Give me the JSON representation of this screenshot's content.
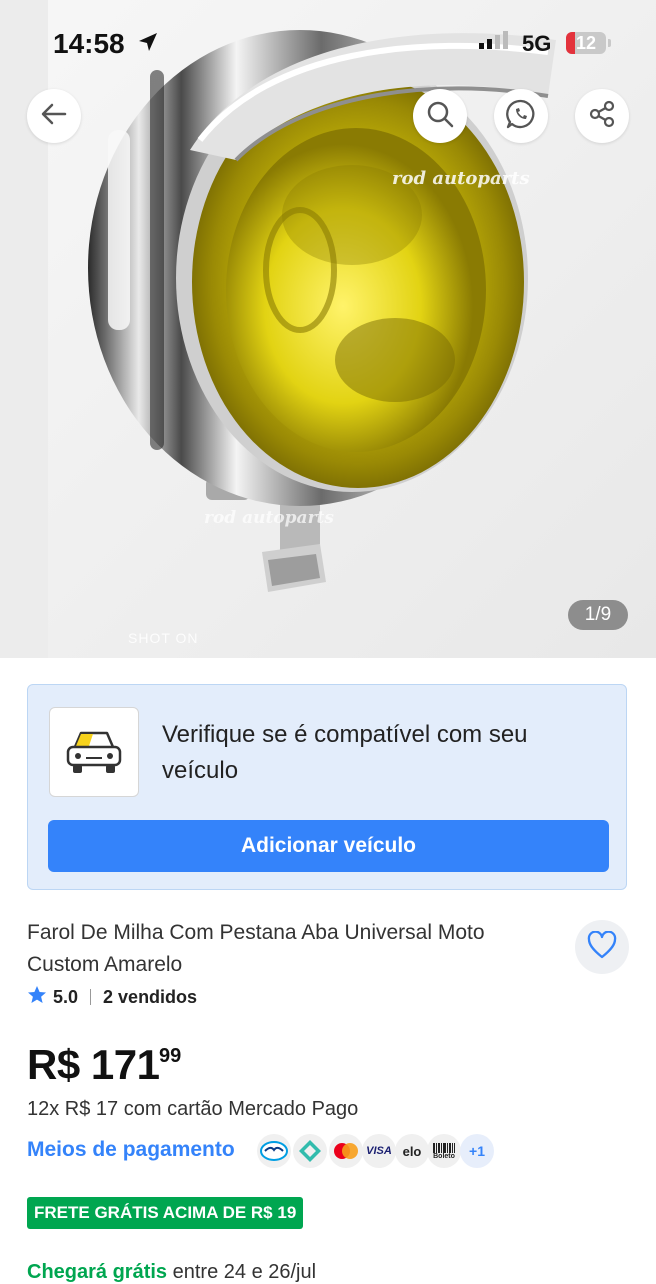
{
  "status_bar": {
    "time": "14:58",
    "network": "5G",
    "battery": "12"
  },
  "gallery": {
    "counter": "1/9",
    "watermarks": [
      "rod autoparts",
      "rod autoparts",
      "SHOT ON"
    ],
    "image_subject": "chrome headlight with yellow lens"
  },
  "toolbar": {
    "icons": [
      "back-arrow-icon",
      "search-icon",
      "whatsapp-icon",
      "share-icon"
    ]
  },
  "compatibility": {
    "text": "Verifique se é compatível com seu veículo",
    "button_label": "Adicionar veículo"
  },
  "product": {
    "title": "Farol De Milha Com Pestana Aba Universal Moto Custom Amarelo",
    "rating": "5.0",
    "sold": "2 vendidos",
    "price_main": "R$ 171",
    "price_cents": "99",
    "installments": "12x R$ 17 com cartão Mercado Pago",
    "payment_link": "Meios de pagamento",
    "payment_icons": [
      "mercado-pago",
      "pix",
      "mastercard",
      "visa",
      "elo",
      "boleto"
    ],
    "payment_visa": "VISA",
    "payment_elo": "elo",
    "payment_boleto": "Boleto",
    "payment_more": "+1",
    "shipping_badge": "FRETE GRÁTIS ACIMA DE R$ 19",
    "delivery_highlight": "Chegará grátis",
    "delivery_rest": " entre 24 e 26/jul"
  },
  "colors": {
    "accent": "#3483fa",
    "green": "#00a650",
    "lens": "#e6da10"
  }
}
